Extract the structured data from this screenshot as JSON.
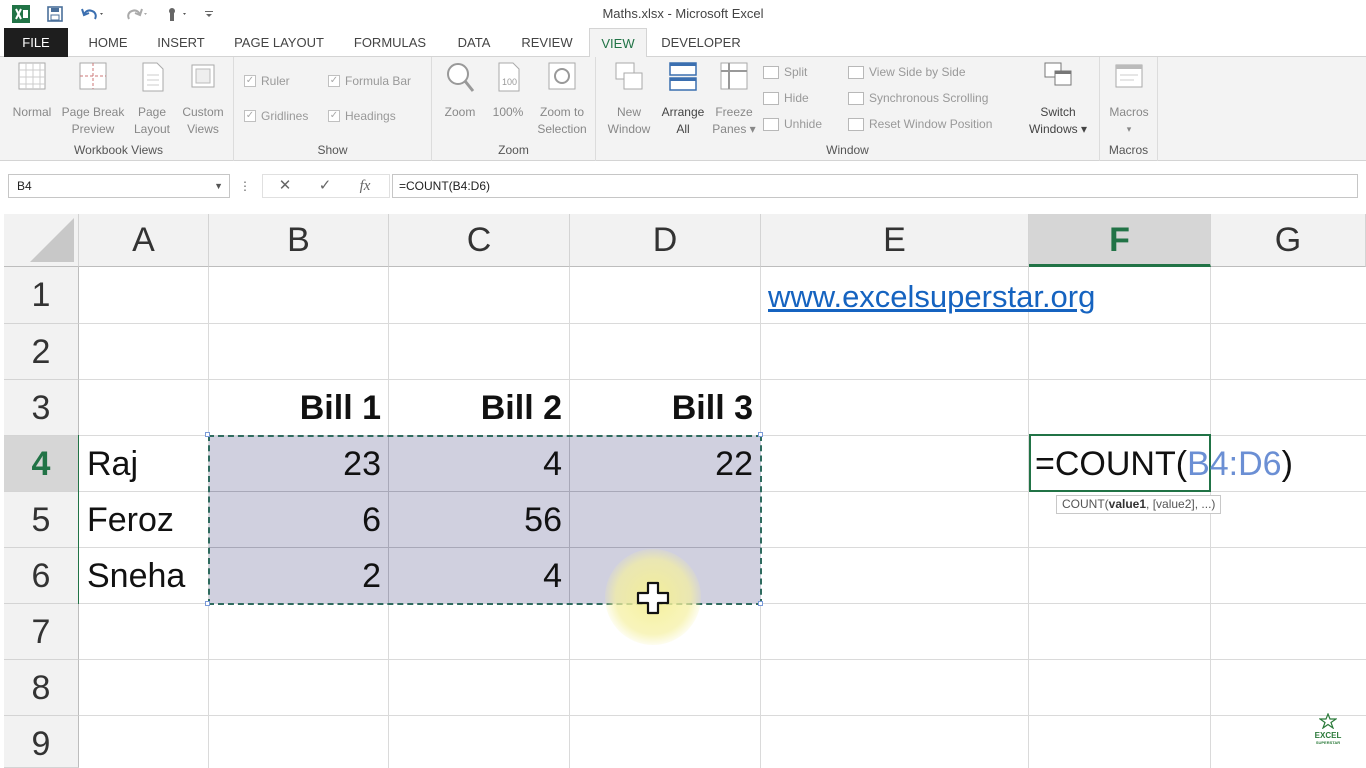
{
  "window": {
    "title": "Maths.xlsx - Microsoft Excel"
  },
  "tabs": [
    {
      "label": "FILE"
    },
    {
      "label": "HOME"
    },
    {
      "label": "INSERT"
    },
    {
      "label": "PAGE LAYOUT"
    },
    {
      "label": "FORMULAS"
    },
    {
      "label": "DATA"
    },
    {
      "label": "REVIEW"
    },
    {
      "label": "VIEW"
    },
    {
      "label": "DEVELOPER"
    }
  ],
  "active_tab": "VIEW",
  "ribbon": {
    "workbook_views": {
      "label": "Workbook Views",
      "buttons": [
        {
          "line1": "Normal",
          "line2": ""
        },
        {
          "line1": "Page Break",
          "line2": "Preview"
        },
        {
          "line1": "Page",
          "line2": "Layout"
        },
        {
          "line1": "Custom",
          "line2": "Views"
        }
      ]
    },
    "show": {
      "label": "Show",
      "ruler": "Ruler",
      "formula_bar": "Formula Bar",
      "gridlines": "Gridlines",
      "headings": "Headings",
      "check": "✓"
    },
    "zoom": {
      "label": "Zoom",
      "zoom_btn": "Zoom",
      "zoom100": "100%",
      "zoom_sel_1": "Zoom to",
      "zoom_sel_2": "Selection"
    },
    "window": {
      "label": "Window",
      "new_1": "New",
      "new_2": "Window",
      "arrange_1": "Arrange",
      "arrange_2": "All",
      "freeze_1": "Freeze",
      "freeze_2": "Panes ▾",
      "split": "Split",
      "hide": "Hide",
      "unhide": "Unhide",
      "side_by_side": "View Side by Side",
      "sync_scroll": "Synchronous Scrolling",
      "reset_pos": "Reset Window Position",
      "switch_1": "Switch",
      "switch_2": "Windows ▾"
    },
    "macros": {
      "label": "Macros",
      "btn": "Macros",
      "arrow": "▾"
    }
  },
  "formula_bar": {
    "name_box": "B4",
    "cancel": "✕",
    "enter": "✓",
    "fx": "fx",
    "formula": "=COUNT(B4:D6)"
  },
  "sheet": {
    "columns": [
      "A",
      "B",
      "C",
      "D",
      "E",
      "F",
      "G"
    ],
    "selected_column": "F",
    "rows": [
      "1",
      "2",
      "3",
      "4",
      "5",
      "6",
      "7",
      "8",
      "9"
    ],
    "selected_row": "4",
    "link": "www.excelsuperstar.org",
    "headers": [
      "Bill 1",
      "Bill 2",
      "Bill 3"
    ],
    "names": [
      "Raj",
      "Feroz",
      "Sneha"
    ],
    "values": [
      [
        "23",
        "4",
        "22"
      ],
      [
        "6",
        "56",
        ""
      ],
      [
        "2",
        "4",
        ""
      ]
    ],
    "active_cell": {
      "prefix": "=COUNT(",
      "ref": "B4:D6",
      "suffix": ")"
    },
    "tooltip": {
      "fn": "COUNT(",
      "arg1": "value1",
      "rest": ", [value2], ...)"
    }
  },
  "watermark": {
    "line1": "EXCEL",
    "line2": "SUPERSTAR"
  },
  "colors": {
    "accent": "#217346",
    "link": "#1563c0",
    "range_fill": "#d0d0df",
    "ref_blue": "#6b8fd4"
  }
}
